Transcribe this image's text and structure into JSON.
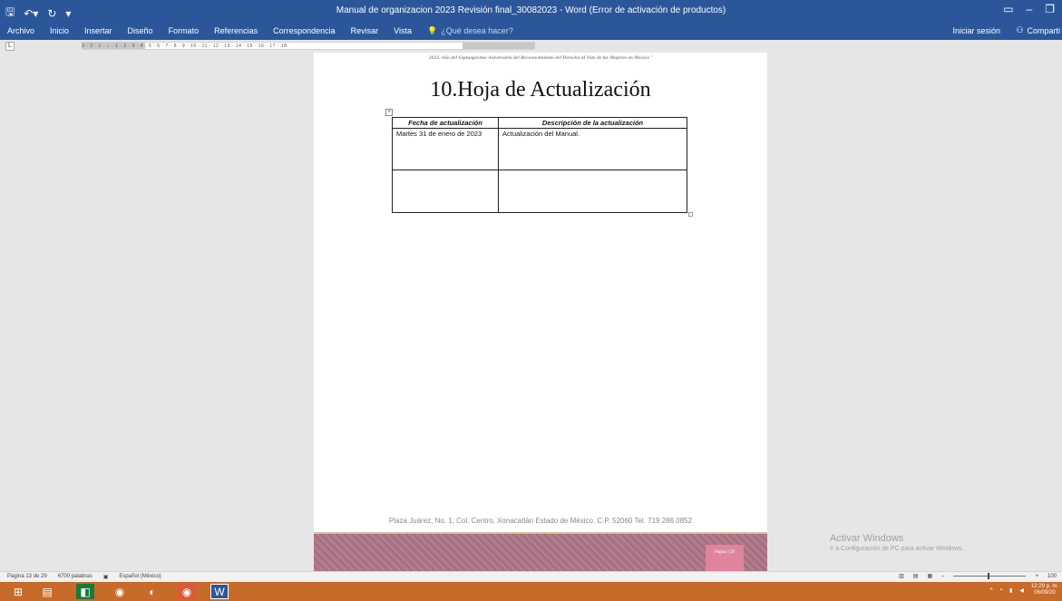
{
  "titlebar": {
    "title": "Manual de organizacion 2023 Revisión final_30082023 - Word (Error de activación de productos)",
    "save_icon": "save-icon",
    "undo_icon": "undo-icon",
    "redo_icon": "redo-icon",
    "brand_color": "#2b579a"
  },
  "ribbon": {
    "tabs": [
      "Archivo",
      "Inicio",
      "Insertar",
      "Diseño",
      "Formato",
      "Referencias",
      "Correspondencia",
      "Revisar",
      "Vista"
    ],
    "tell_me_placeholder": "¿Qué desea hacer?",
    "signin": "Iniciar sesión",
    "share": "Comparti"
  },
  "ruler": {
    "tab_selector": "L",
    "scale": "3 · 2 · 1 · ⌂ · 1 · 2 · 3 · 4 · 5 · 6 · 7 · 8 · 9 · 10 · 11 · 12 · 13 · 14 · 15 · 16 · 17 · 18"
  },
  "document": {
    "header_text": "2023. Año del Septuagésimo Aniversario del Reconocimiento del Derecho al Voto de las Mujeres en México\"",
    "heading": "10.Hoja de Actualización",
    "table": {
      "headers": [
        "Fecha de actualización",
        "Descripción de la actualización"
      ],
      "rows": [
        [
          "Martes 31 de enero de 2023",
          "Actualización del Manual."
        ],
        [
          "",
          ""
        ]
      ]
    },
    "footer_address": "Plaza Juárez, No. 1, Col. Centro, Xonacatlán Estado de México. C.P. 52060 Tel. 719 286 0852",
    "page_label": "Página | 29"
  },
  "watermark": {
    "title": "Activar Windows",
    "subtitle": "Ir a Configuración de PC para activar Windows."
  },
  "statusbar": {
    "page": "Página 13 de 29",
    "words": "6700 palabras",
    "language": "Español (México)",
    "zoom": "100"
  },
  "taskbar": {
    "time": "12:29 p. m.",
    "date": "06/09/20",
    "color": "#c86a2a"
  }
}
